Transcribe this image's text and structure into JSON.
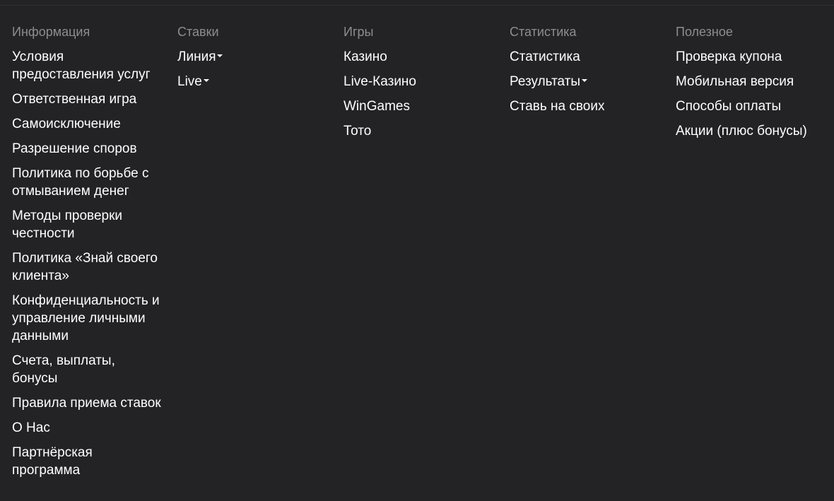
{
  "footer": {
    "columns": [
      {
        "title": "Информация",
        "links": [
          "Условия предоставления услуг",
          "Ответственная игра",
          "Самоисключение",
          "Разрешение споров",
          "Политика по борьбе с отмыванием денег",
          "Методы проверки честности",
          "Политика «Знай своего клиента»",
          "Конфиденциальность и управление личными данными",
          "Счета, выплаты, бонусы",
          "Правила приема ставок",
          "О Нас",
          "Партнёрская программа"
        ]
      },
      {
        "title": "Ставки",
        "links": [
          "Линия",
          "Live"
        ]
      },
      {
        "title": "Игры",
        "links": [
          "Казино",
          "Live-Казино",
          "WinGames",
          "Тото"
        ]
      },
      {
        "title": "Статистика",
        "links": [
          "Статистика",
          "Результаты",
          "Ставь на своих"
        ]
      },
      {
        "title": "Полезное",
        "links": [
          "Проверка купона",
          "Мобильная версия",
          "Способы оплаты",
          "Акции (плюс бонусы)"
        ]
      }
    ]
  },
  "icons": {
    "dropdown": "caret-down-icon"
  }
}
